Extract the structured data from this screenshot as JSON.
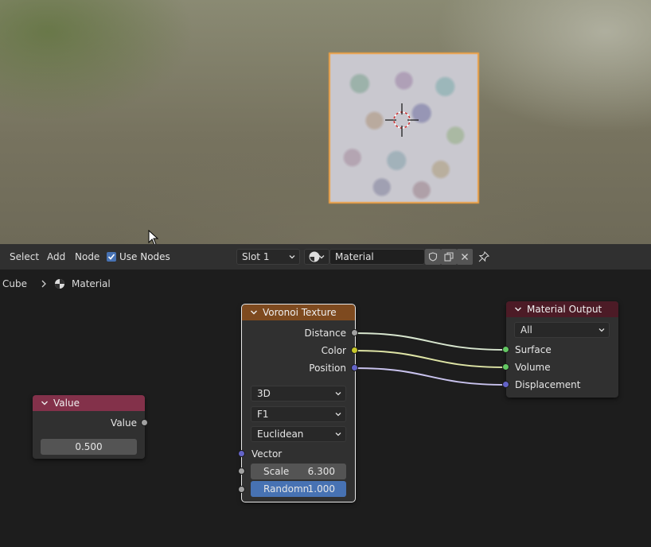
{
  "viewport": {
    "object_name": "cube-object"
  },
  "header": {
    "menus": [
      "Select",
      "Add",
      "Node"
    ],
    "use_nodes_label": "Use Nodes",
    "use_nodes_checked": true,
    "slot_value": "Slot 1",
    "material_name": "Material"
  },
  "breadcrumb": {
    "object": "Cube",
    "material": "Material"
  },
  "nodes": {
    "value": {
      "title": "Value",
      "output_label": "Value",
      "field_value": "0.500",
      "header_color": "#83314a"
    },
    "voronoi": {
      "title": "Voronoi Texture",
      "outputs": [
        "Distance",
        "Color",
        "Position"
      ],
      "dimensions": "3D",
      "feature": "F1",
      "metric": "Euclidean",
      "vector_label": "Vector",
      "scale_label": "Scale",
      "scale_value": "6.300",
      "randomness_label": "Randomn",
      "randomness_value": "1.000",
      "header_color": "#7e4a1f"
    },
    "output": {
      "title": "Material Output",
      "target": "All",
      "inputs": [
        "Surface",
        "Volume",
        "Displacement"
      ],
      "header_color": "#4c1b26"
    }
  },
  "colors": {
    "accent": "#4772b3",
    "socket_gray": "#a1a1a1",
    "socket_yellow": "#c7c729",
    "socket_purple": "#6363c7",
    "socket_green": "#63c763",
    "selection_orange": "#f0a040"
  }
}
